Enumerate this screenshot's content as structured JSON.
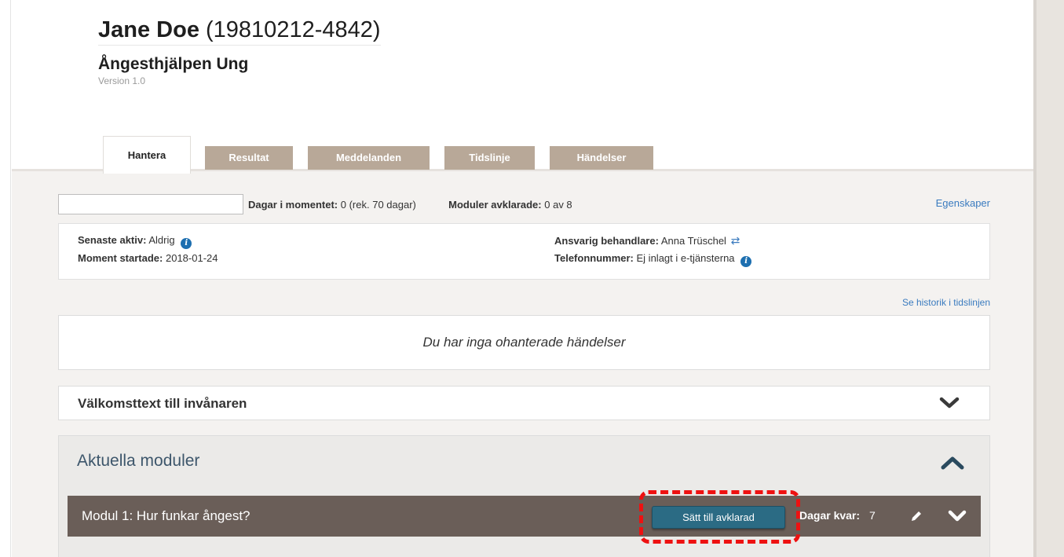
{
  "patient": {
    "name": "Jane Doe",
    "id": "(19810212-4842)"
  },
  "program": {
    "title": "Ångesthjälpen Ung",
    "version": "Version 1.0"
  },
  "tabs": [
    {
      "label": "Hantera",
      "active": true
    },
    {
      "label": "Resultat",
      "active": false
    },
    {
      "label": "Meddelanden",
      "active": false
    },
    {
      "label": "Tidslinje",
      "active": false
    },
    {
      "label": "Händelser",
      "active": false
    }
  ],
  "filter": {
    "value": "",
    "placeholder": ""
  },
  "stats": {
    "days_label": "Dagar i momentet:",
    "days_value": "0 (rek. 70 dagar)",
    "modules_label": "Moduler avklarade:",
    "modules_value": "0 av 8"
  },
  "properties_link": "Egenskaper",
  "info": {
    "last_active_label": "Senaste aktiv:",
    "last_active_value": "Aldrig",
    "started_label": "Moment startade:",
    "started_value": "2018-01-24",
    "therapist_label": "Ansvarig behandlare:",
    "therapist_value": "Anna Trüschel",
    "phone_label": "Telefonnummer:",
    "phone_value": "Ej inlagt i e-tjänsterna"
  },
  "history_link": "Se historik i tidslinjen",
  "events_message": "Du har inga ohanterade händelser",
  "welcome_section": {
    "label": "Välkomsttext till invånaren",
    "expanded": false
  },
  "modules": {
    "title": "Aktuella moduler",
    "expanded": true,
    "items": [
      {
        "name": "Modul 1: Hur funkar ångest?",
        "button_label": "Sätt till avklarad",
        "days_left_label": "Dagar kvar:",
        "days_left_value": "7"
      }
    ]
  },
  "colors": {
    "tab_inactive": "#b8a898",
    "module_row": "#6a5e58",
    "primary_button": "#2b6b84",
    "link": "#3a7bbf",
    "highlight": "#ee1111"
  },
  "icons": [
    "info-icon",
    "swap-icon",
    "chevron-down-icon",
    "chevron-up-icon",
    "pencil-icon"
  ]
}
